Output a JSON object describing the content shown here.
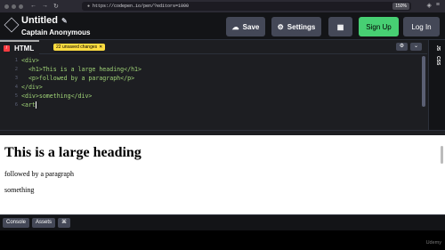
{
  "browser": {
    "url": "https://codepen.io/pen/?editors=1000",
    "zoom": "150%"
  },
  "header": {
    "pen_title": "Untitled",
    "owner": "Captain Anonymous",
    "save_label": "Save",
    "settings_label": "Settings",
    "signup_label": "Sign Up",
    "login_label": "Log In"
  },
  "editor": {
    "tab_label": "HTML",
    "unsaved_badge": "22 unsaved changes",
    "side_labels": [
      "JS",
      "CSS"
    ],
    "lines": [
      {
        "num": "1",
        "code": "<div>"
      },
      {
        "num": "2",
        "code": "  <h1>This is a large heading</h1>"
      },
      {
        "num": "3",
        "code": "  <p>followed by a paragraph</p>"
      },
      {
        "num": "4",
        "code": "</div>"
      },
      {
        "num": "5",
        "code": "<div>something</div>"
      },
      {
        "num": "6",
        "code": "<art"
      }
    ]
  },
  "preview": {
    "heading": "This is a large heading",
    "paragraph": "followed by a paragraph",
    "div_text": "something"
  },
  "footer": {
    "console_label": "Console",
    "assets_label": "Assets",
    "shortcuts_label": "⌘"
  },
  "watermark": "Udemy",
  "colors": {
    "accent_green": "#47cf73",
    "html_red": "#ff3c41",
    "unsaved_yellow": "#ffdd40"
  }
}
